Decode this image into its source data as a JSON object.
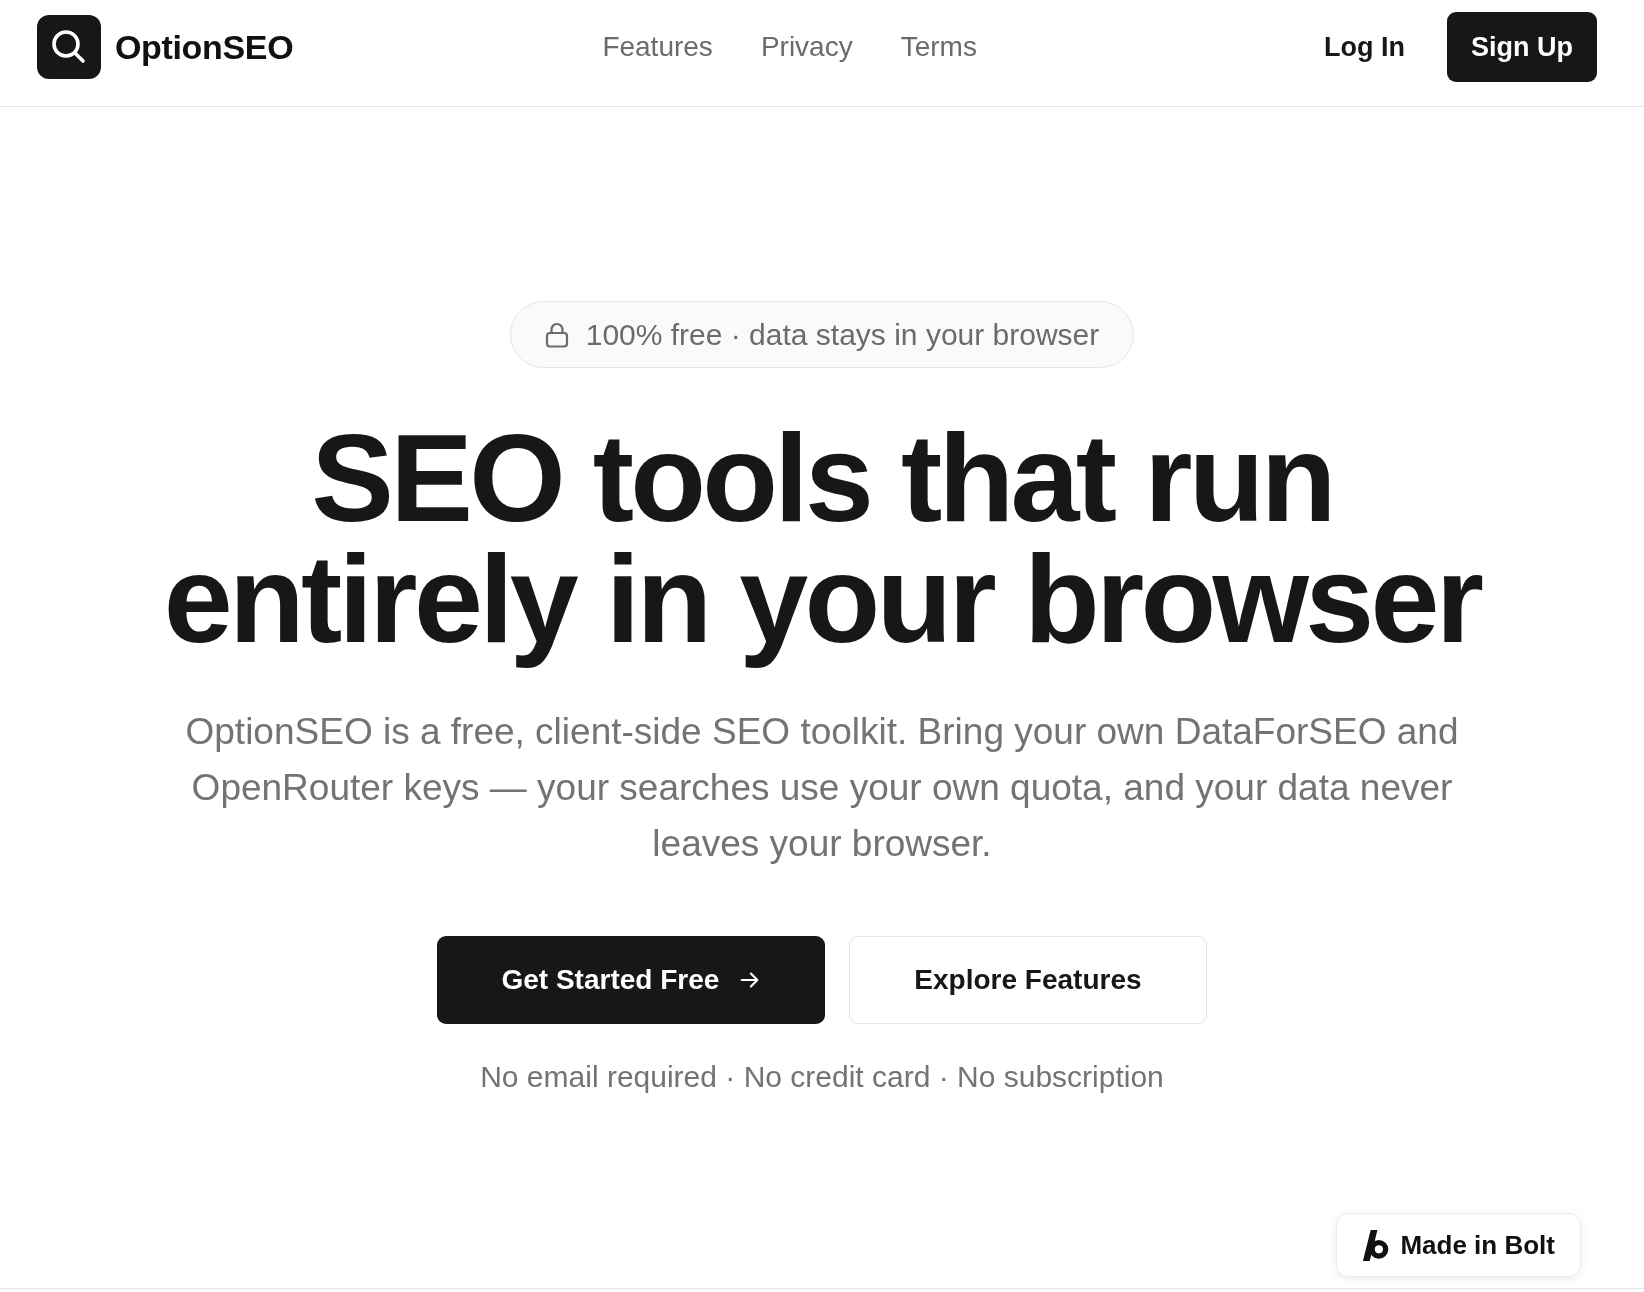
{
  "header": {
    "logo_text": "OptionSEO",
    "nav": [
      {
        "label": "Features"
      },
      {
        "label": "Privacy"
      },
      {
        "label": "Terms"
      }
    ],
    "login": "Log In",
    "signup": "Sign Up"
  },
  "hero": {
    "badge": "100% free · data stays in your browser",
    "headline": "SEO tools that run entirely in your browser",
    "description": "OptionSEO is a free, client-side SEO toolkit. Bring your own DataForSEO and OpenRouter keys — your searches use your own quota, and your data never leaves your browser.",
    "buttons": [
      {
        "label": "Get Started Free",
        "kind": "primary"
      },
      {
        "label": "Explore Features",
        "kind": "secondary"
      }
    ],
    "note": "No email required · No credit card · No subscription"
  },
  "floating_badge": {
    "label": "Made in Bolt"
  }
}
